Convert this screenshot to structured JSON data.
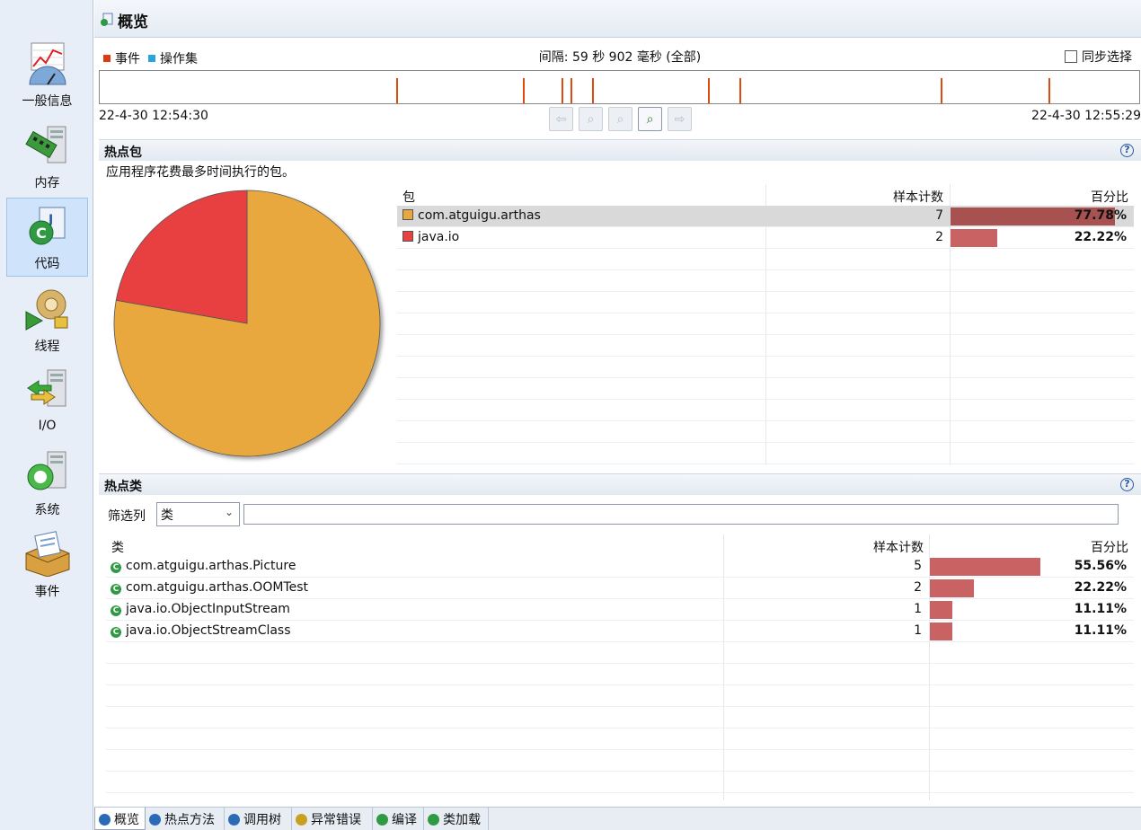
{
  "nav": {
    "items": [
      {
        "label": "一般信息",
        "icon": "telemetry-chart-icon"
      },
      {
        "label": "内存",
        "icon": "memory-icon"
      },
      {
        "label": "代码",
        "icon": "code-icon",
        "active": true
      },
      {
        "label": "线程",
        "icon": "threads-icon"
      },
      {
        "label": "I/O",
        "icon": "io-icon"
      },
      {
        "label": "系统",
        "icon": "system-icon"
      },
      {
        "label": "事件",
        "icon": "events-icon"
      }
    ]
  },
  "header": {
    "title": "概览"
  },
  "timeline": {
    "legend_events": "事件",
    "legend_opsets": "操作集",
    "interval": "间隔: 59 秒 902 毫秒 (全部)",
    "sync_label": "同步选择",
    "start": "22-4-30 12:54:30",
    "end": "22-4-30 12:55:29",
    "event_fractions": [
      0.285,
      0.407,
      0.444,
      0.453,
      0.474,
      0.585,
      0.615,
      0.809,
      0.913
    ]
  },
  "hot_packages": {
    "title": "热点包",
    "description": "应用程序花费最多时间执行的包。",
    "columns": [
      "包",
      "样本计数",
      "百分比"
    ],
    "rows": [
      {
        "name": "com.atguigu.arthas",
        "count": "7",
        "percent": "77.78%",
        "value": 77.78,
        "color": "#e8a83e"
      },
      {
        "name": "java.io",
        "count": "2",
        "percent": "22.22%",
        "value": 22.22,
        "color": "#e84141"
      }
    ]
  },
  "chart_data": {
    "type": "pie",
    "categories": [
      "com.atguigu.arthas",
      "java.io"
    ],
    "values": [
      77.78,
      22.22
    ],
    "colors": [
      "#e8a83e",
      "#e84141"
    ]
  },
  "hot_classes": {
    "title": "热点类",
    "filter_label": "筛选列",
    "filter_value": "类",
    "filter_text": "",
    "columns": [
      "类",
      "样本计数",
      "百分比"
    ],
    "rows": [
      {
        "name": "com.atguigu.arthas.Picture",
        "count": "5",
        "percent": "55.56%",
        "value": 55.56
      },
      {
        "name": "com.atguigu.arthas.OOMTest",
        "count": "2",
        "percent": "22.22%",
        "value": 22.22
      },
      {
        "name": "java.io.ObjectInputStream",
        "count": "1",
        "percent": "11.11%",
        "value": 11.11
      },
      {
        "name": "java.io.ObjectStreamClass",
        "count": "1",
        "percent": "11.11%",
        "value": 11.11
      }
    ]
  },
  "tabs": [
    {
      "label": "概览",
      "active": true
    },
    {
      "label": "热点方法"
    },
    {
      "label": "调用树"
    },
    {
      "label": "异常错误"
    },
    {
      "label": "编译"
    },
    {
      "label": "类加载"
    }
  ],
  "help_glyph": "?"
}
